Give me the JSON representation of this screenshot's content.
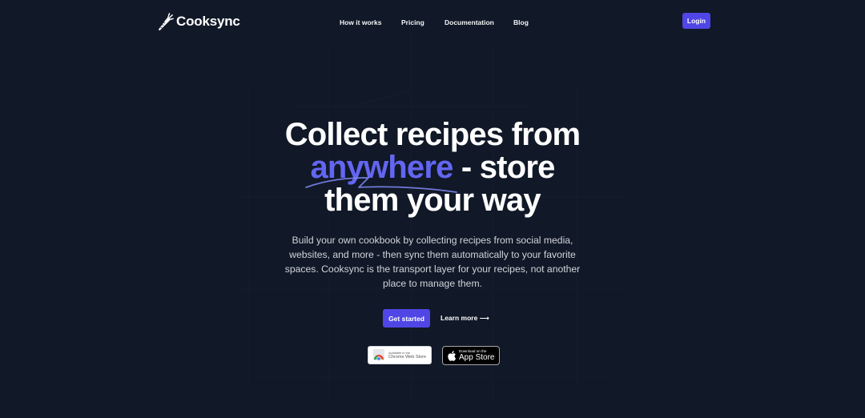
{
  "brand": {
    "name": "Cooksync",
    "logo_icon": "carrot-icon"
  },
  "nav": {
    "items": [
      {
        "label": "How it works"
      },
      {
        "label": "Pricing"
      },
      {
        "label": "Documentation"
      },
      {
        "label": "Blog"
      }
    ],
    "login_label": "Login"
  },
  "hero": {
    "title_line1": "Collect recipes from",
    "title_accent": "anywhere",
    "title_line2_rest": " - store",
    "title_line3": "them your way",
    "subtitle": "Build your own cookbook by collecting recipes from social media, websites, and more - then sync them automatically to your favorite spaces. Cooksync is the transport layer for your recipes, not another place to manage them.",
    "cta_primary": "Get started",
    "cta_secondary": "Learn more ⟶"
  },
  "badges": {
    "chrome": {
      "small": "Available in the",
      "big": "Chrome Web Store",
      "icon": "chrome-icon"
    },
    "apple": {
      "small": "Download on the",
      "big": "App Store",
      "icon": "apple-icon"
    }
  },
  "colors": {
    "background": "#111827",
    "accent": "#4f46e5",
    "accent_text": "#6366f1",
    "text": "#ffffff",
    "muted_text": "#d1d5db"
  }
}
